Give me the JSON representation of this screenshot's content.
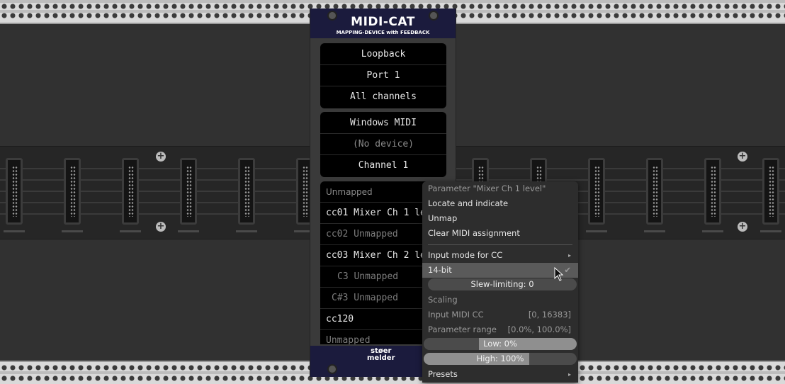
{
  "module": {
    "title": "MIDI-CAT",
    "subtitle": "MAPPING-DEVICE with FEEDBACK",
    "brand_line1": "støer",
    "brand_line2": "melder",
    "input": {
      "driver": "Loopback",
      "device": "Port 1",
      "channel": "All channels"
    },
    "output": {
      "driver": "Windows MIDI",
      "device": "(No device)",
      "channel": "Channel 1"
    },
    "mappings": [
      {
        "text": "Unmapped",
        "state": "unmapped"
      },
      {
        "text": "cc01 Mixer Ch 1 level",
        "state": "mapped"
      },
      {
        "text": "cc02 Unmapped",
        "state": "unmapped"
      },
      {
        "text": "cc03 Mixer Ch 2 level",
        "state": "mapped"
      },
      {
        "text": "C3 Unmapped",
        "state": "unmapped"
      },
      {
        "text": "C#3 Unmapped",
        "state": "unmapped"
      },
      {
        "text": "cc120",
        "state": "mapped"
      },
      {
        "text": "Unmapped",
        "state": "unmapped"
      }
    ]
  },
  "context_menu": {
    "header": "Parameter \"Mixer Ch 1 level\"",
    "locate": "Locate and indicate",
    "unmap": "Unmap",
    "clear": "Clear MIDI assignment",
    "input_mode": "Input mode for CC",
    "bit_mode": "14-bit",
    "bit_mode_check": "✔",
    "slew_limiting": "Slew-limiting: 0",
    "slew_limiting_level": 0,
    "scaling_label": "Scaling",
    "input_midi_cc_label": "Input MIDI CC",
    "input_midi_cc_value": "[0, 16383]",
    "param_range_label": "Parameter range",
    "param_range_value": "[0.0%, 100.0%]",
    "low": "Low: 0%",
    "low_level": 0,
    "high": "High: 100%",
    "high_level": 100,
    "presets": "Presets",
    "submenu_arrow": "▸"
  }
}
